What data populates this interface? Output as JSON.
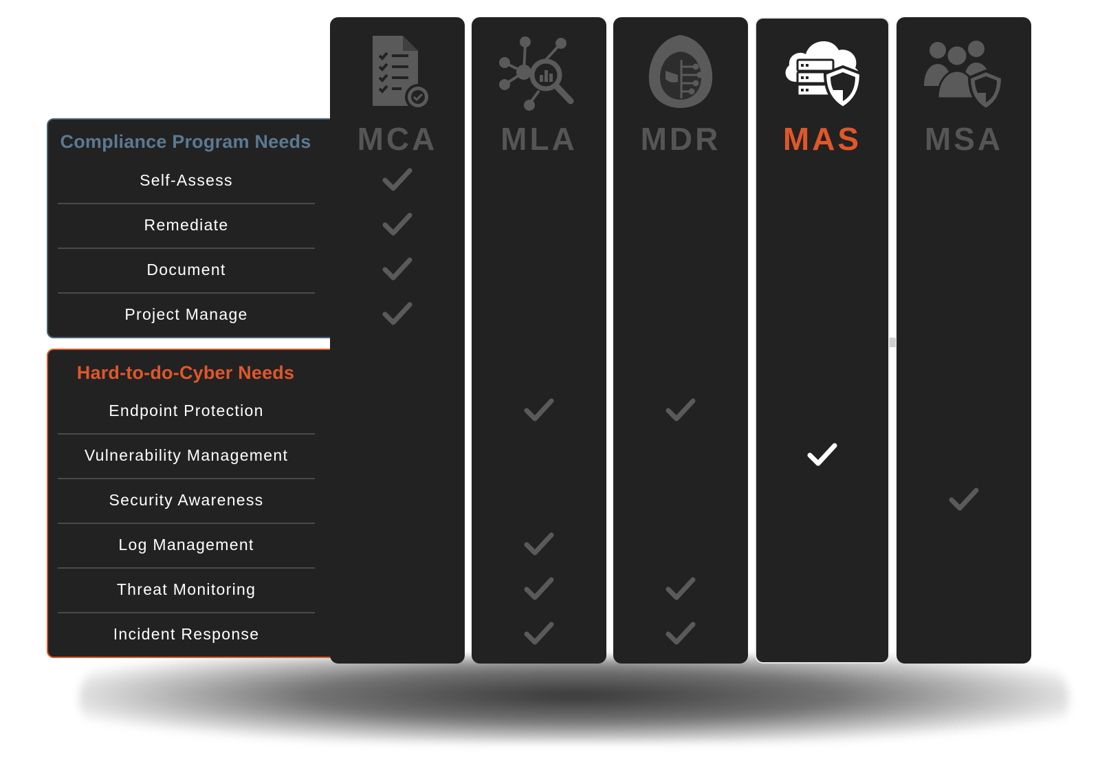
{
  "sections": [
    {
      "title": "Compliance Program Needs",
      "title_color": "#5a7a92",
      "rows": [
        "Self-Assess",
        "Remediate",
        "Document",
        "Project Manage"
      ]
    },
    {
      "title": "Hard-to-do-Cyber Needs",
      "title_color": "#e0572a",
      "rows": [
        "Endpoint Protection",
        "Vulnerability Management",
        "Security Awareness",
        "Log Management",
        "Threat Monitoring",
        "Incident Response"
      ]
    }
  ],
  "columns": [
    {
      "label": "MCA",
      "icon": "checklist-document-icon",
      "highlighted": false
    },
    {
      "label": "MLA",
      "icon": "log-analytics-icon",
      "highlighted": false
    },
    {
      "label": "MDR",
      "icon": "hooded-hacker-icon",
      "highlighted": false
    },
    {
      "label": "MAS",
      "icon": "cloud-server-shield-icon",
      "highlighted": true
    },
    {
      "label": "MSA",
      "icon": "users-shield-icon",
      "highlighted": false
    }
  ],
  "checks": {
    "MCA": [
      "Self-Assess",
      "Remediate",
      "Document",
      "Project Manage"
    ],
    "MLA": [
      "Endpoint Protection",
      "Log Management",
      "Threat Monitoring",
      "Incident Response"
    ],
    "MDR": [
      "Endpoint Protection",
      "Threat Monitoring",
      "Incident Response"
    ],
    "MAS": [
      "Vulnerability Management"
    ],
    "MSA": [
      "Security Awareness"
    ]
  },
  "colors": {
    "panel": "#222222",
    "muted": "#555555",
    "accent": "#e0572a",
    "check": "#5a5a5a",
    "check_active": "#ffffff"
  }
}
